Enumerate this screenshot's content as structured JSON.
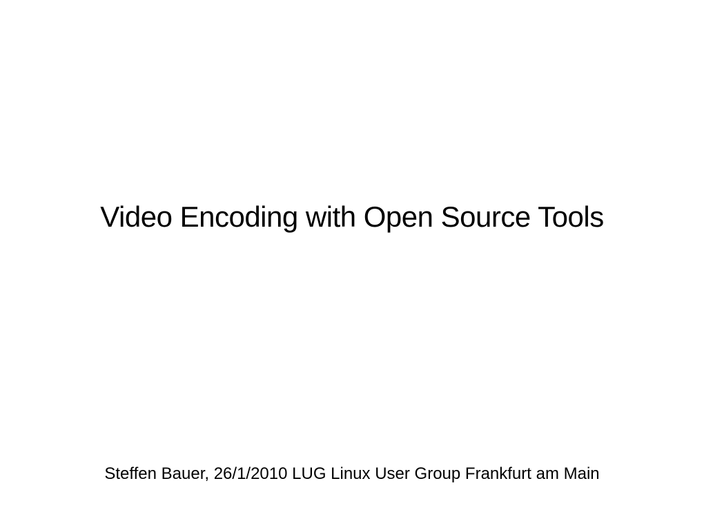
{
  "slide": {
    "title": "Video Encoding with Open Source Tools",
    "footer": "Steffen Bauer, 26/1/2010 LUG Linux User Group Frankfurt am Main"
  }
}
